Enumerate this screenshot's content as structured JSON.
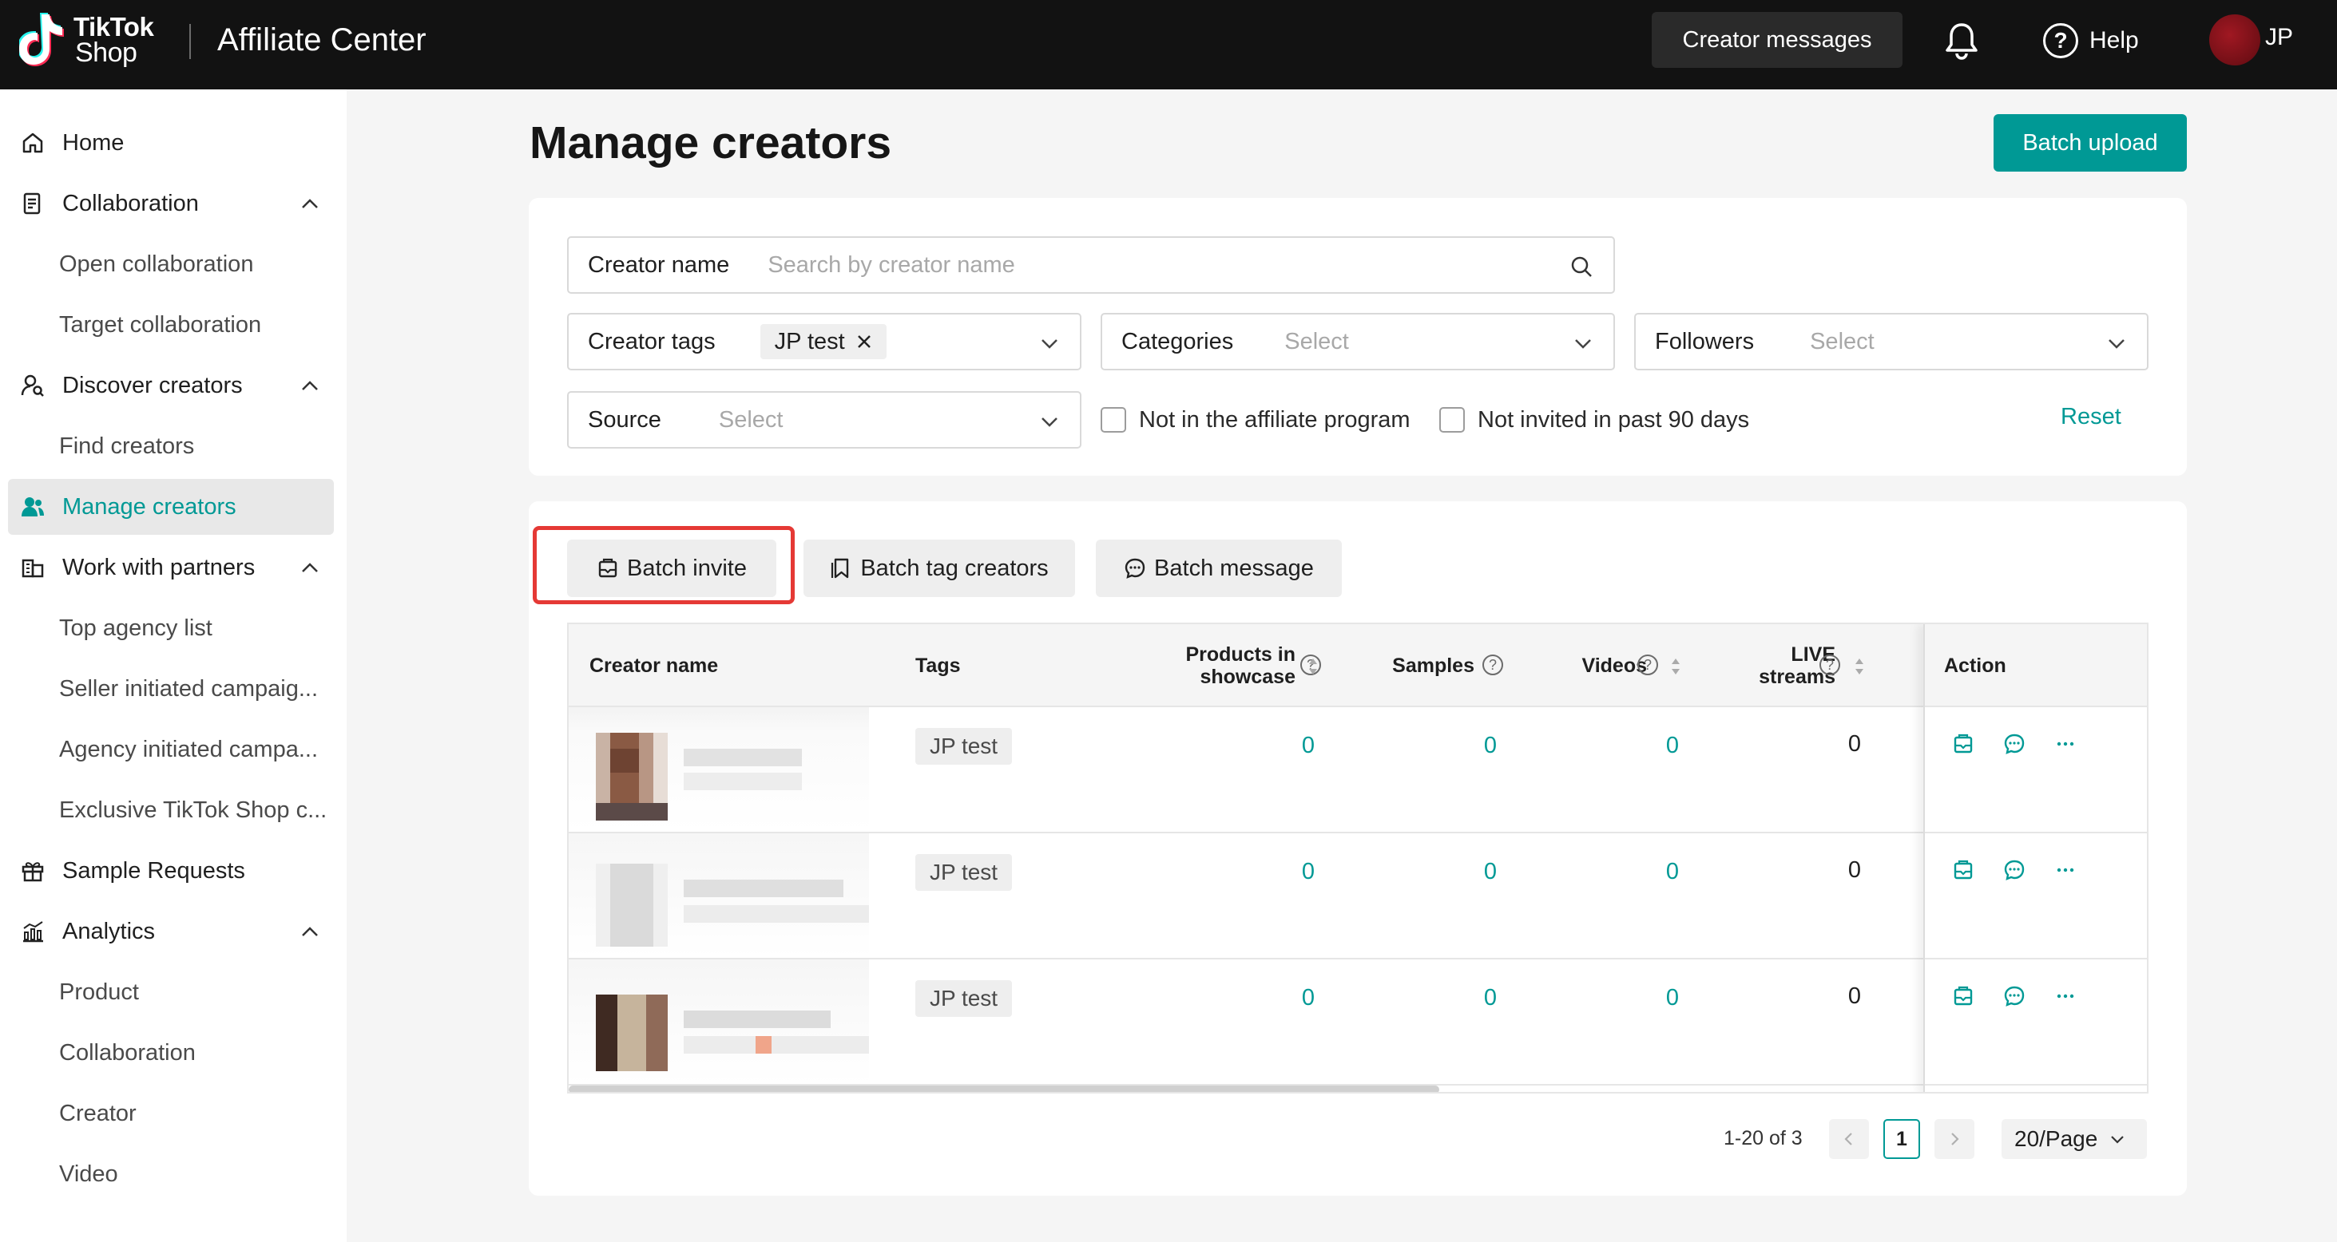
{
  "header": {
    "brand_line1": "TikTok",
    "brand_line2": "Shop",
    "app_title": "Affiliate Center",
    "creator_messages": "Creator messages",
    "help": "Help",
    "user_initials": "JP"
  },
  "sidebar": {
    "items": [
      {
        "label": "Home",
        "icon": "home-icon"
      },
      {
        "label": "Collaboration",
        "icon": "collaboration-icon"
      },
      {
        "label": "Open collaboration"
      },
      {
        "label": "Target collaboration"
      },
      {
        "label": "Discover creators",
        "icon": "discover-icon"
      },
      {
        "label": "Find creators"
      },
      {
        "label": "Manage creators",
        "icon": "people-icon",
        "active": true
      },
      {
        "label": "Work with partners",
        "icon": "partners-icon"
      },
      {
        "label": "Top agency list"
      },
      {
        "label": "Seller initiated campaig..."
      },
      {
        "label": "Agency initiated campa..."
      },
      {
        "label": "Exclusive TikTok Shop c..."
      },
      {
        "label": "Sample Requests",
        "icon": "gift-icon"
      },
      {
        "label": "Analytics",
        "icon": "analytics-icon"
      },
      {
        "label": "Product"
      },
      {
        "label": "Collaboration"
      },
      {
        "label": "Creator"
      },
      {
        "label": "Video"
      }
    ]
  },
  "main": {
    "title": "Manage creators",
    "batch_upload": "Batch upload",
    "filters": {
      "creator_name_label": "Creator name",
      "creator_name_placeholder": "Search by creator name",
      "creator_tags_label": "Creator tags",
      "creator_tags_value": "JP test",
      "categories_label": "Categories",
      "categories_placeholder": "Select",
      "followers_label": "Followers",
      "followers_placeholder": "Select",
      "source_label": "Source",
      "source_placeholder": "Select",
      "not_in_affiliate": "Not in the affiliate program",
      "not_invited": "Not invited in past 90 days",
      "reset": "Reset"
    },
    "toolbar": {
      "batch_invite": "Batch invite",
      "batch_tag": "Batch tag creators",
      "batch_message": "Batch message"
    },
    "table": {
      "columns": {
        "creator_name": "Creator name",
        "tags": "Tags",
        "products_line1": "Products in",
        "products_line2": "showcase",
        "samples": "Samples",
        "videos": "Videos",
        "live_line1": "LIVE",
        "live_line2": "streams",
        "action": "Action"
      },
      "rows": [
        {
          "tag": "JP test",
          "products": "0",
          "samples": "0",
          "videos": "0",
          "live": "0"
        },
        {
          "tag": "JP test",
          "products": "0",
          "samples": "0",
          "videos": "0",
          "live": "0"
        },
        {
          "tag": "JP test",
          "products": "0",
          "samples": "0",
          "videos": "0",
          "live": "0"
        }
      ]
    },
    "pagination": {
      "summary": "1-20 of 3",
      "current_page": "1",
      "page_size": "20/Page"
    }
  },
  "colors": {
    "accent": "#009995",
    "highlight": "#e53935",
    "topbar": "#121212"
  }
}
